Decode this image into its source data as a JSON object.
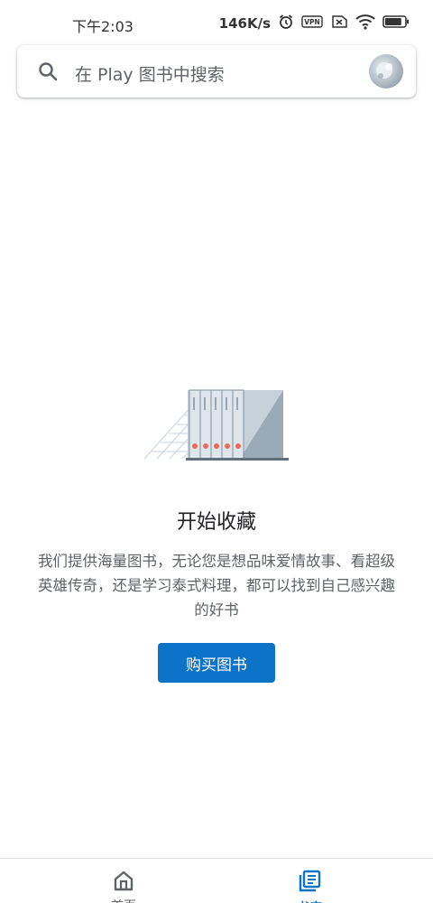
{
  "status_bar": {
    "time": "下午2:03",
    "speed": "146K/s",
    "vpn": "VPN",
    "battery_level": 0.85
  },
  "search": {
    "placeholder": "在 Play 图书中搜索"
  },
  "empty_state": {
    "title": "开始收藏",
    "description": "我们提供海量图书，无论您是想品味爱情故事、看超级英雄传奇，还是学习泰式料理，都可以找到自己感兴趣的好书",
    "button_label": "购买图书"
  },
  "bottom_nav": {
    "items": [
      {
        "label": "首页",
        "icon": "home-icon",
        "selected": false
      },
      {
        "label": "书库",
        "icon": "library-icon",
        "selected": true
      }
    ]
  },
  "colors": {
    "accent": "#0b73c8",
    "text_secondary": "#5f6368"
  }
}
